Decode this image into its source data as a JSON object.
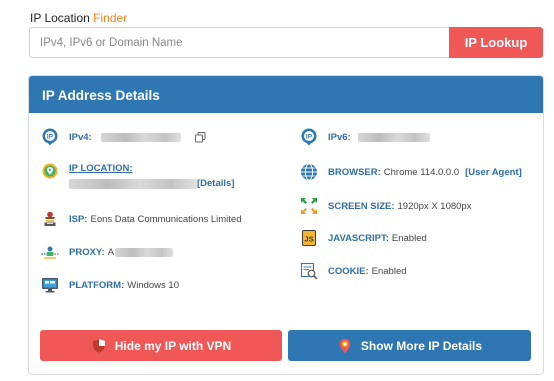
{
  "finder": {
    "title_prefix": "IP Location",
    "title_accent": "Finder",
    "input_placeholder": "IPv4, IPv6 or Domain Name",
    "button_label": "IP Lookup"
  },
  "details": {
    "header": "IP Address Details",
    "ipv4_label": "IPv4:",
    "ipv6_label": "IPv6:",
    "location_label": "IP LOCATION:",
    "location_details_link": "[Details]",
    "browser_label": "BROWSER:",
    "browser_value": "Chrome 114.0.0.0",
    "user_agent_link": "[User Agent]",
    "screen_label": "SCREEN SIZE:",
    "screen_value": "1920px X 1080px",
    "isp_label": "ISP:",
    "isp_value": "Eons Data Communications Limited",
    "javascript_label": "JAVASCRIPT:",
    "javascript_value": "Enabled",
    "proxy_label": "PROXY:",
    "proxy_value_prefix": "A",
    "cookie_label": "COOKIE:",
    "cookie_value": "Enabled",
    "platform_label": "PLATFORM:",
    "platform_value": "Windows 10"
  },
  "actions": {
    "vpn_label": "Hide my IP with VPN",
    "more_label": "Show More IP Details"
  },
  "colors": {
    "accent_orange": "#f58220",
    "brand_red": "#f05757",
    "brand_blue": "#2e77b3",
    "label_blue": "#2e6fa8"
  },
  "icons": [
    "ip-badge-icon",
    "copy-icon",
    "map-pin-icon",
    "globe-icon",
    "resize-arrows-icon",
    "isp-tower-icon",
    "javascript-icon",
    "proxy-network-icon",
    "cookie-icon",
    "platform-monitor-icon",
    "shield-icon",
    "location-pin-icon"
  ]
}
